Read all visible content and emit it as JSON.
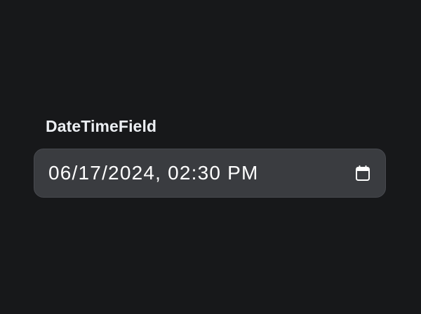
{
  "field": {
    "label": "DateTimeField",
    "value": "06/17/2024, 02:30 PM"
  },
  "icons": {
    "picker": "calendar-icon"
  },
  "colors": {
    "background": "#17181a",
    "input_background": "#3a3c40",
    "text": "#ffffff"
  }
}
